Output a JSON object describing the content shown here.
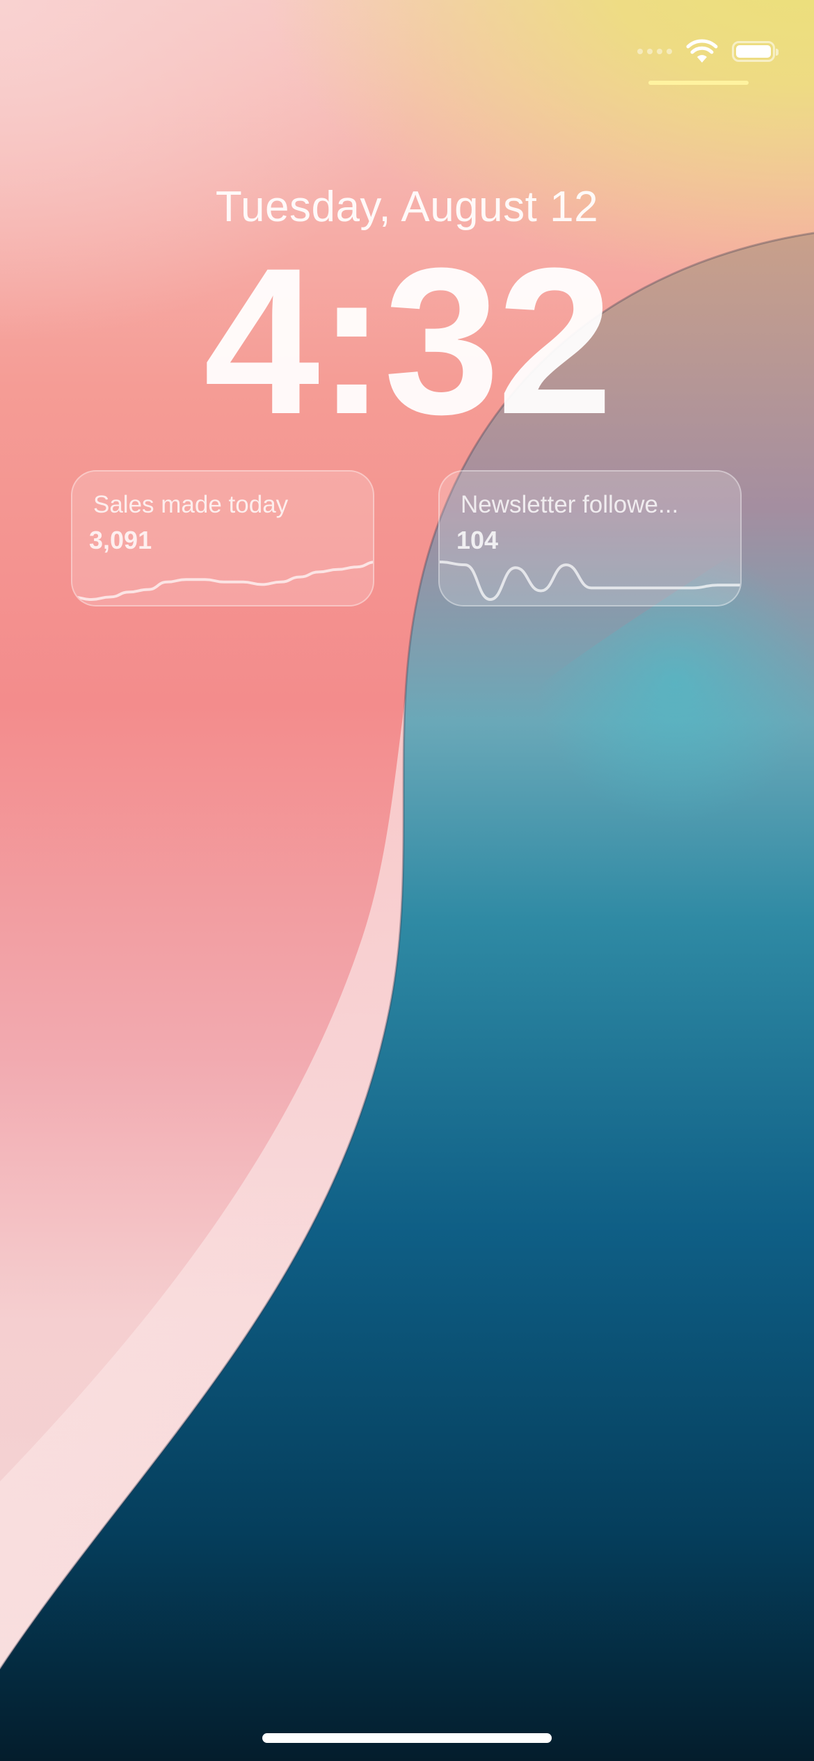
{
  "status_bar": {
    "wifi_icon": "wifi-icon",
    "battery_icon": "battery-icon",
    "battery_level": 1.0
  },
  "lock_screen": {
    "date": "Tuesday, August 12",
    "time": "4:32"
  },
  "widgets": [
    {
      "title": "Sales made today",
      "value": "3,091",
      "sparkline": [
        2,
        1,
        2,
        4,
        5,
        8,
        9,
        9,
        8,
        8,
        7,
        8,
        10,
        12,
        13,
        14,
        16
      ]
    },
    {
      "title": "Newsletter followe...",
      "value": "104",
      "sparkline": [
        16,
        15,
        3,
        14,
        6,
        15,
        7,
        7,
        7,
        7,
        7,
        8,
        8
      ]
    }
  ],
  "colors": {
    "status_underline": "#fff3a0",
    "sparkline": "#ffffff"
  }
}
